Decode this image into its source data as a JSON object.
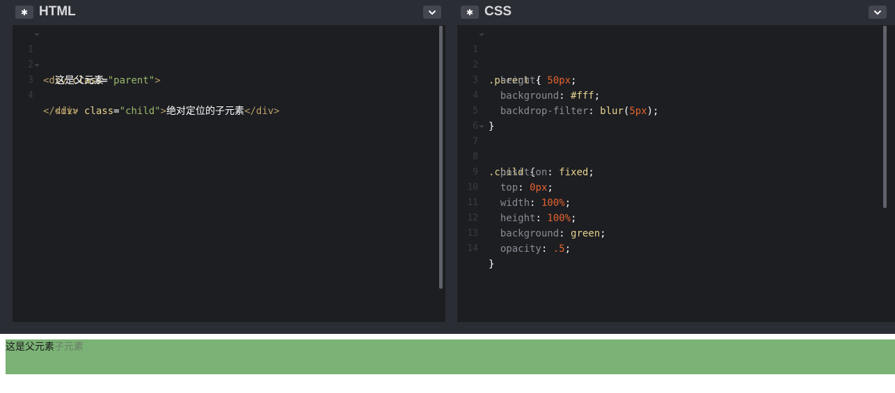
{
  "html_panel": {
    "title": "HTML",
    "gear_icon": "gear-icon",
    "dropdown_icon": "chevron-down-icon",
    "lines": [
      {
        "num": "1",
        "fold": true
      },
      {
        "num": "2",
        "fold": false
      },
      {
        "num": "3",
        "fold": true
      },
      {
        "num": "4",
        "fold": false
      }
    ],
    "code": {
      "l1_open": "<div ",
      "l1_attr": "class",
      "l1_eq": "=",
      "l1_str": "\"parent\"",
      "l1_close": ">",
      "l2_text": "  这是父元素",
      "l3_open": "  <div ",
      "l3_attr": "class",
      "l3_eq": "=",
      "l3_str": "\"child\"",
      "l3_close": ">",
      "l3_text": "绝对定位的子元素",
      "l3_end": "</div>",
      "l4_end": "</div>"
    }
  },
  "css_panel": {
    "title": "CSS",
    "gear_icon": "gear-icon",
    "dropdown_icon": "chevron-down-icon",
    "line_numbers": [
      "1",
      "2",
      "3",
      "4",
      "5",
      "6",
      "7",
      "8",
      "9",
      "10",
      "11",
      "12",
      "13",
      "14"
    ],
    "code": {
      "l1_sel": ".parent",
      "l1_brace": " {",
      "l2_prop": "  height",
      "l2_val": "50px",
      "l3_prop": "  background",
      "l3_val": "#fff",
      "l4_prop": "  backdrop-filter",
      "l4_fn": "blur",
      "l4_val": "5px",
      "l5_brace": "}",
      "l7_sel": ".child",
      "l7_brace": " {",
      "l8_prop": "  position",
      "l8_val": "fixed",
      "l9_prop": "  top",
      "l9_val": "0px",
      "l10_prop": "  width",
      "l10_val": "100%",
      "l11_prop": "  height",
      "l11_val": "100%",
      "l12_prop": "  background",
      "l12_val": "green",
      "l13_prop": "  opacity",
      "l13_val": ".5",
      "l14_brace": "}"
    }
  },
  "preview": {
    "parent_text": "这是父元素",
    "child_text": "子元素",
    "child_bg": "#7bb276"
  },
  "colors": {
    "editor_bg": "#1d1e22",
    "chrome_bg": "#2b2d35",
    "tag": "#b8a068",
    "string": "#9ab86a",
    "number": "#e5632e",
    "keyword": "#e6d38e"
  }
}
